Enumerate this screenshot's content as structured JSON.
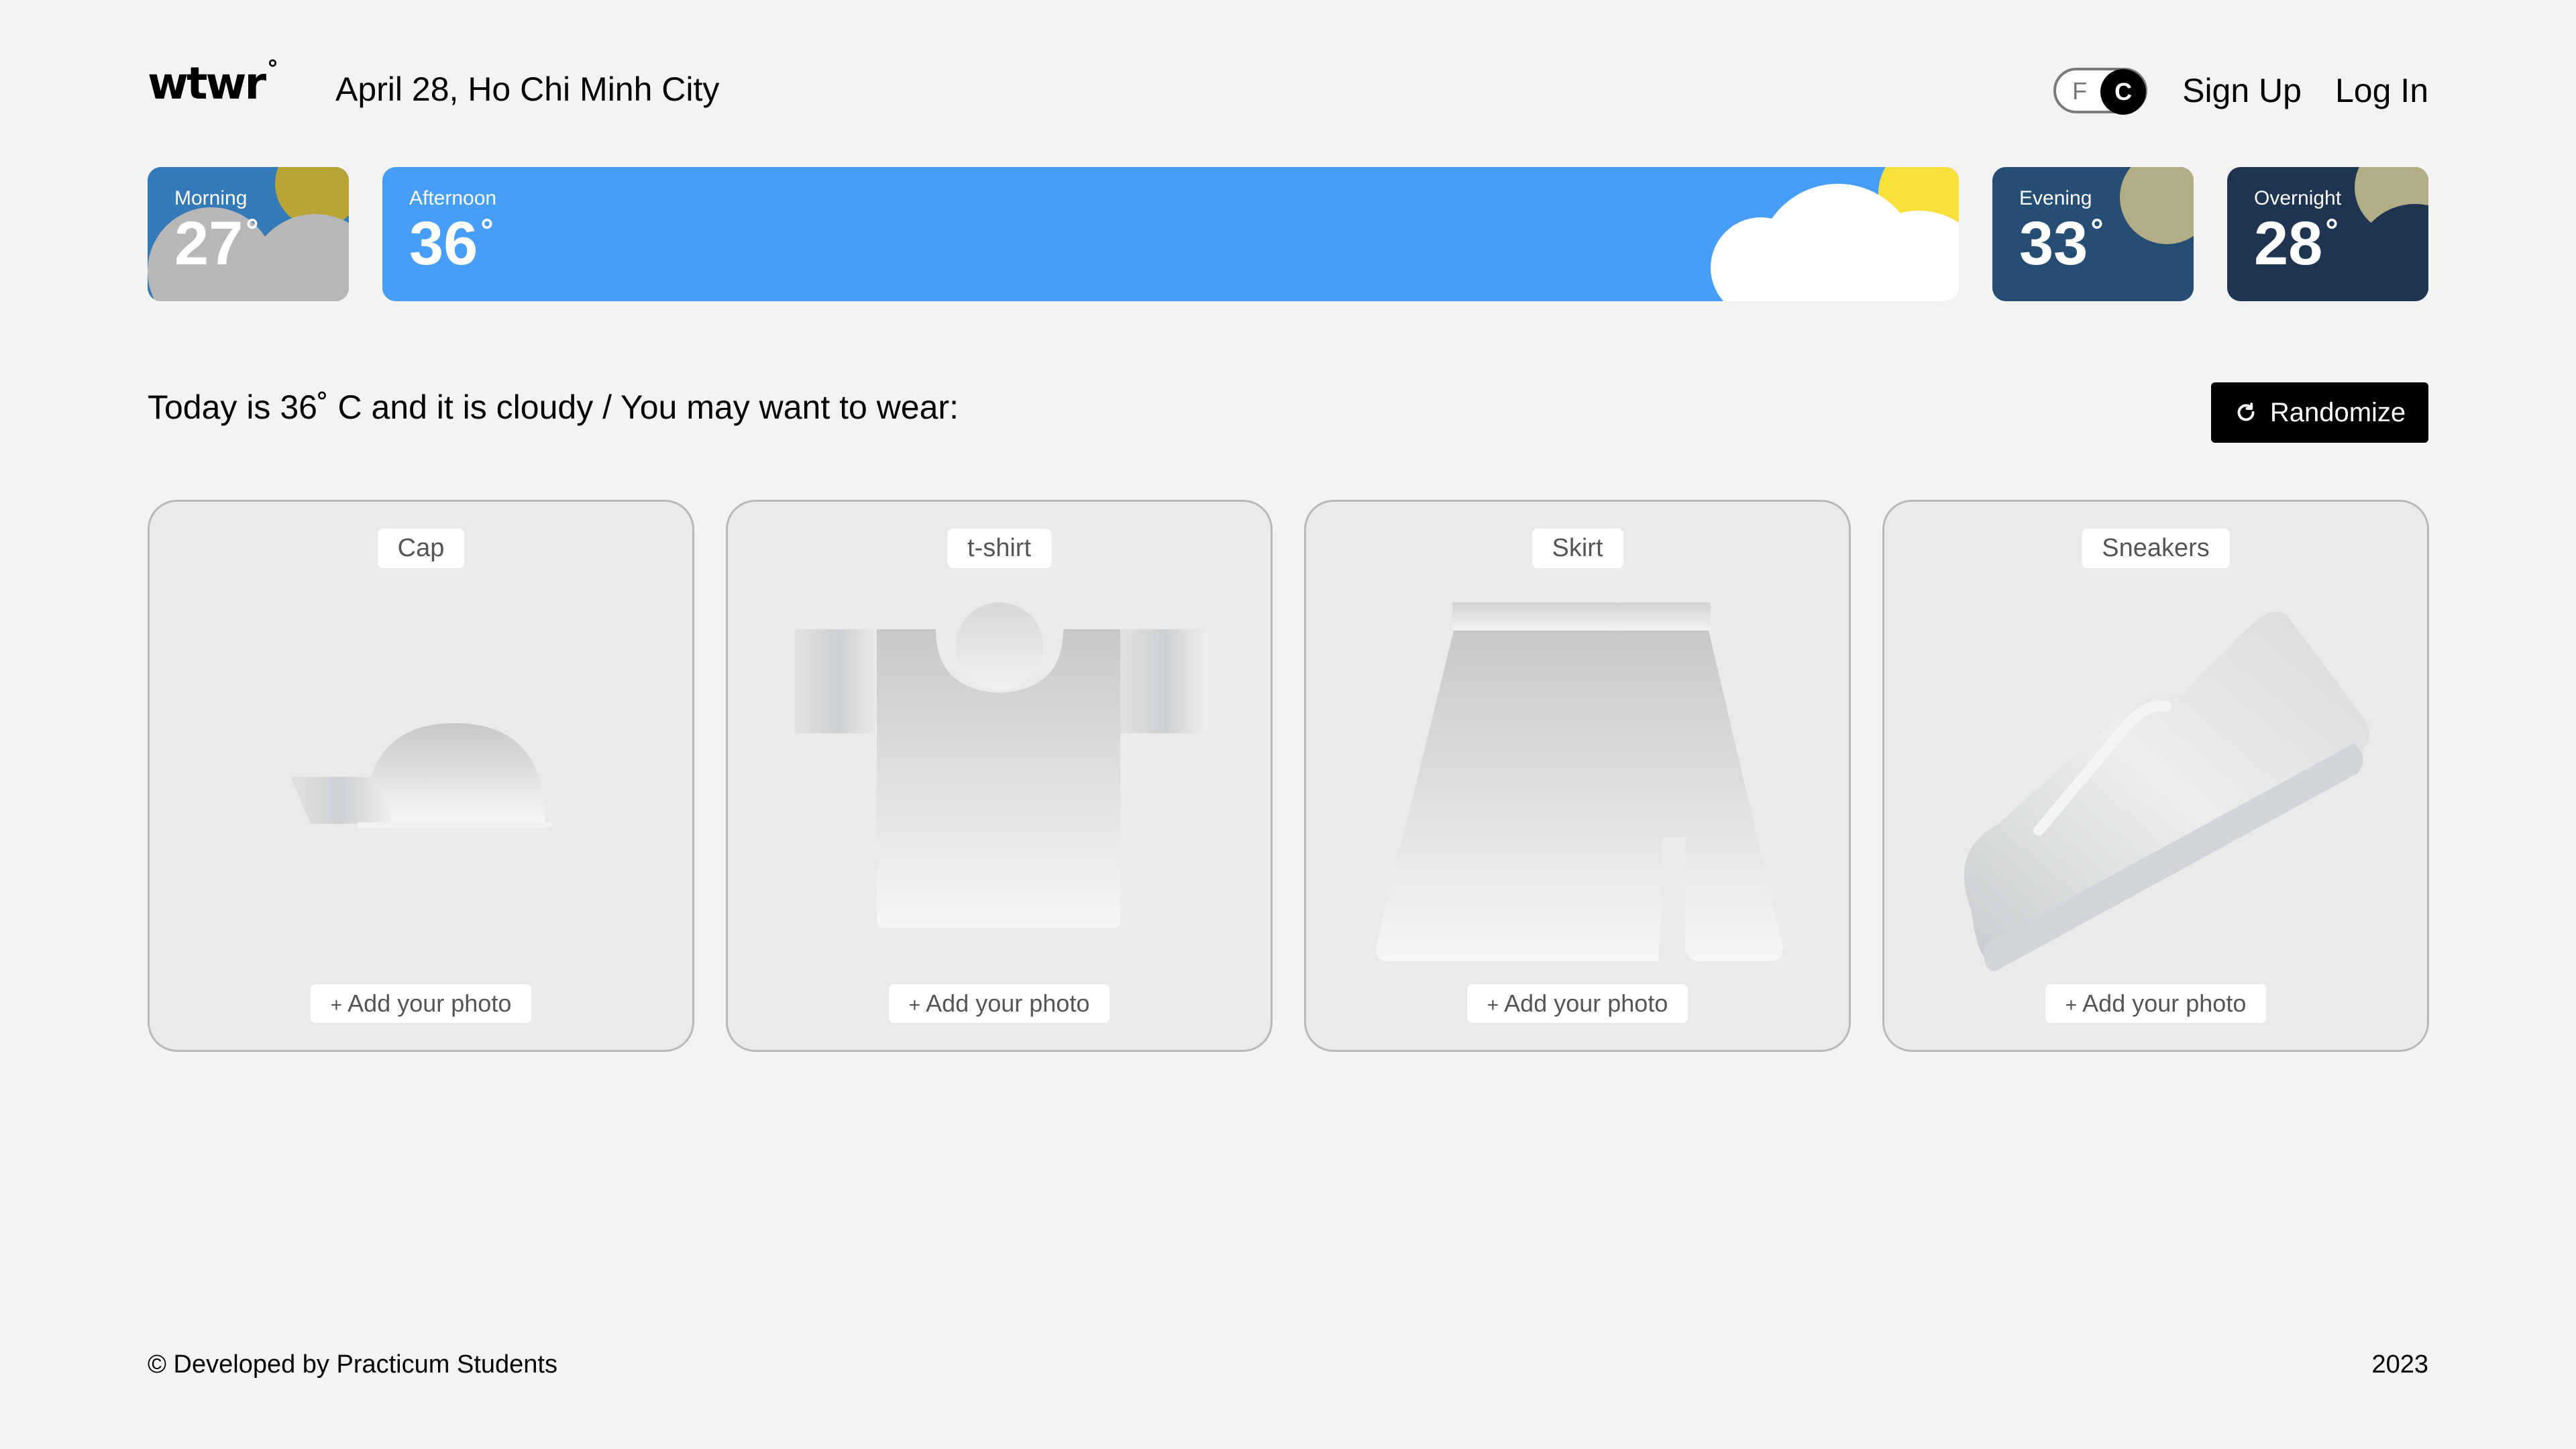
{
  "header": {
    "logo": "wtwr",
    "logo_degree": "°",
    "date_location": "April 28, Ho Chi Minh City",
    "toggle": {
      "f_label": "F",
      "c_label": "C",
      "active": "C"
    },
    "signup_label": "Sign Up",
    "login_label": "Log In"
  },
  "weather": {
    "morning": {
      "label": "Morning",
      "temp": "27",
      "degree": "°"
    },
    "afternoon": {
      "label": "Afternoon",
      "temp": "36",
      "degree": "°"
    },
    "evening": {
      "label": "Evening",
      "temp": "33",
      "degree": "°"
    },
    "overnight": {
      "label": "Overnight",
      "temp": "28",
      "degree": "°"
    }
  },
  "recommendation": {
    "text": "Today is 36˚ C and it is cloudy / You may want to wear:",
    "randomize_label": "Randomize"
  },
  "items": [
    {
      "name": "Cap",
      "add_photo_label": "Add your photo",
      "plus": "+"
    },
    {
      "name": "t-shirt",
      "add_photo_label": "Add your photo",
      "plus": "+"
    },
    {
      "name": "Skirt",
      "add_photo_label": "Add your photo",
      "plus": "+"
    },
    {
      "name": "Sneakers",
      "add_photo_label": "Add your photo",
      "plus": "+"
    }
  ],
  "footer": {
    "developer": "© Developed by Practicum Students",
    "year": "2023"
  },
  "colors": {
    "background": "#f3f3f3",
    "morning": "#3479b8",
    "afternoon": "#479ef6",
    "evening": "#264d74",
    "overnight": "#1f3450",
    "sun": "#f9e03a"
  }
}
